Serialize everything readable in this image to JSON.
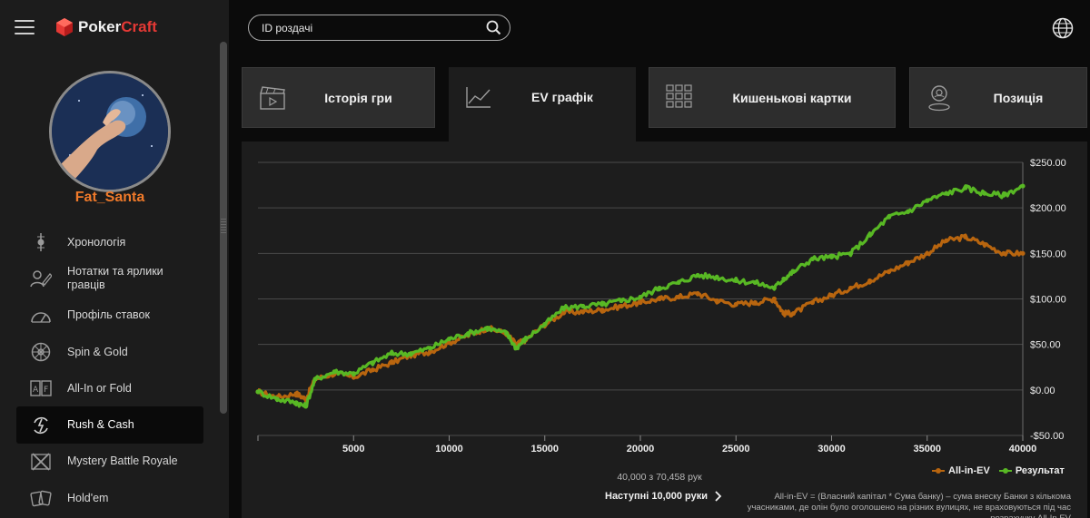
{
  "brand": {
    "name_part1": "Poker",
    "name_part2": "Craft"
  },
  "user": {
    "name": "Fat_Santa"
  },
  "search": {
    "placeholder": "ID роздачі"
  },
  "sidebar": {
    "items": [
      {
        "label": "Хронологія",
        "icon": "timeline-icon"
      },
      {
        "label": "Нотатки та ярлики гравців",
        "icon": "notes-icon"
      },
      {
        "label": "Профіль ставок",
        "icon": "gauge-icon"
      },
      {
        "label": "Spin & Gold",
        "icon": "spin-wheel-icon"
      },
      {
        "label": "All-In or Fold",
        "icon": "allin-fold-icon"
      },
      {
        "label": "Rush & Cash",
        "icon": "rush-cash-icon",
        "active": true
      },
      {
        "label": "Mystery Battle Royale",
        "icon": "crossed-swords-icon"
      },
      {
        "label": "Hold'em",
        "icon": "cards-icon"
      }
    ]
  },
  "tabs": [
    {
      "label": "Історія гри",
      "icon": "clapperboard-icon"
    },
    {
      "label": "EV графік",
      "icon": "line-chart-icon",
      "active": true
    },
    {
      "label": "Кишенькові картки",
      "icon": "grid-icon"
    },
    {
      "label": "Позиція",
      "icon": "position-icon"
    }
  ],
  "pagination": {
    "count_text": "40,000 з 70,458 рук",
    "next_label": "Наступні 10,000 руки"
  },
  "legend": {
    "allin_ev": "All-in-EV",
    "result": "Результат"
  },
  "footnote": "All-in-EV = (Власний капітал * Сума банку) – сума внеску Банки з кількома учасниками, де олін було оголошено на різних вулицях, не враховуються під час розрахунку All-In EV",
  "colors": {
    "allin_ev": "#b8650f",
    "result": "#58b824",
    "accent": "#f07a2a"
  },
  "chart_data": {
    "type": "line",
    "xlim": [
      0,
      40000
    ],
    "ylim": [
      -50,
      250
    ],
    "x_ticks": [
      5000,
      10000,
      15000,
      20000,
      25000,
      30000,
      35000,
      40000
    ],
    "y_ticks": [
      "$250.00",
      "$200.00",
      "$150.00",
      "$100.00",
      "$50.00",
      "$0.00",
      "-$50.00"
    ],
    "y_tick_values": [
      250,
      200,
      150,
      100,
      50,
      0,
      -50
    ],
    "grid": true,
    "legend_position": "bottom-right",
    "series": [
      {
        "name": "All-in-EV",
        "color": "#b8650f",
        "x": [
          0,
          1000,
          2000,
          2500,
          3000,
          4000,
          5000,
          6000,
          7000,
          8000,
          9000,
          10000,
          11000,
          12000,
          13000,
          13500,
          14000,
          15000,
          16000,
          17000,
          18000,
          19000,
          20000,
          21000,
          22000,
          23000,
          24000,
          25000,
          26000,
          27000,
          27500,
          28000,
          29000,
          30000,
          31000,
          32000,
          33000,
          34000,
          35000,
          36000,
          37000,
          38000,
          39000,
          40000
        ],
        "y": [
          -2,
          -8,
          -4,
          -10,
          12,
          18,
          14,
          22,
          30,
          38,
          42,
          52,
          60,
          68,
          62,
          50,
          55,
          72,
          85,
          86,
          88,
          92,
          96,
          100,
          102,
          106,
          98,
          94,
          96,
          100,
          84,
          84,
          96,
          104,
          112,
          120,
          130,
          140,
          150,
          164,
          168,
          160,
          150,
          150
        ]
      },
      {
        "name": "Результат",
        "color": "#58b824",
        "x": [
          0,
          1000,
          2000,
          2500,
          3000,
          4000,
          5000,
          6000,
          7000,
          8000,
          9000,
          10000,
          11000,
          12000,
          13000,
          13500,
          14000,
          15000,
          16000,
          17000,
          18000,
          19000,
          20000,
          21000,
          22000,
          23000,
          24000,
          25000,
          26000,
          27000,
          27500,
          28000,
          29000,
          30000,
          31000,
          32000,
          33000,
          34000,
          35000,
          36000,
          37000,
          38000,
          39000,
          40000
        ],
        "y": [
          -2,
          -10,
          -14,
          -18,
          12,
          20,
          18,
          30,
          40,
          40,
          46,
          56,
          62,
          68,
          62,
          46,
          56,
          72,
          90,
          92,
          94,
          98,
          102,
          112,
          118,
          126,
          124,
          120,
          118,
          112,
          122,
          130,
          144,
          146,
          150,
          170,
          190,
          196,
          208,
          216,
          222,
          216,
          214,
          224
        ]
      }
    ]
  }
}
